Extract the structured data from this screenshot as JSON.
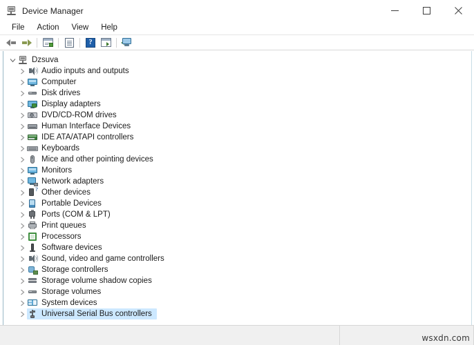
{
  "window": {
    "title": "Device Manager",
    "title_icon": "device-manager-icon",
    "controls": {
      "minimize": "minimize-icon",
      "maximize": "maximize-icon",
      "close": "close-icon"
    }
  },
  "menubar": {
    "items": [
      {
        "label": "File"
      },
      {
        "label": "Action"
      },
      {
        "label": "View"
      },
      {
        "label": "Help"
      }
    ]
  },
  "toolbar": {
    "buttons": [
      {
        "name": "back-arrow-icon",
        "tip": "Back"
      },
      {
        "name": "forward-arrow-icon",
        "tip": "Forward"
      },
      {
        "name": "properties-icon",
        "tip": "Properties"
      },
      {
        "name": "update-driver-icon",
        "tip": "Update driver"
      },
      {
        "name": "help-icon",
        "tip": "Help",
        "glyph": "?"
      },
      {
        "name": "scan-hardware-icon",
        "tip": "Scan for hardware changes"
      },
      {
        "name": "show-devices-icon",
        "tip": "Show devices"
      }
    ]
  },
  "tree": {
    "root": {
      "label": "Dzsuva",
      "icon": "computer-root-icon",
      "expanded": true
    },
    "items": [
      {
        "label": "Audio inputs and outputs",
        "icon": "speaker-icon"
      },
      {
        "label": "Computer",
        "icon": "monitor-icon"
      },
      {
        "label": "Disk drives",
        "icon": "disk-drive-icon"
      },
      {
        "label": "Display adapters",
        "icon": "display-adapter-icon"
      },
      {
        "label": "DVD/CD-ROM drives",
        "icon": "dvd-drive-icon"
      },
      {
        "label": "Human Interface Devices",
        "icon": "hid-icon"
      },
      {
        "label": "IDE ATA/ATAPI controllers",
        "icon": "ide-controller-icon"
      },
      {
        "label": "Keyboards",
        "icon": "keyboard-icon"
      },
      {
        "label": "Mice and other pointing devices",
        "icon": "mouse-icon"
      },
      {
        "label": "Monitors",
        "icon": "monitor-icon"
      },
      {
        "label": "Network adapters",
        "icon": "network-adapter-icon"
      },
      {
        "label": "Other devices",
        "icon": "unknown-device-icon"
      },
      {
        "label": "Portable Devices",
        "icon": "portable-device-icon"
      },
      {
        "label": "Ports (COM & LPT)",
        "icon": "port-plug-icon"
      },
      {
        "label": "Print queues",
        "icon": "printer-icon"
      },
      {
        "label": "Processors",
        "icon": "processor-icon"
      },
      {
        "label": "Software devices",
        "icon": "software-device-icon"
      },
      {
        "label": "Sound, video and game controllers",
        "icon": "speaker-icon"
      },
      {
        "label": "Storage controllers",
        "icon": "storage-controller-icon"
      },
      {
        "label": "Storage volume shadow copies",
        "icon": "storage-stack-icon"
      },
      {
        "label": "Storage volumes",
        "icon": "disk-drive-icon"
      },
      {
        "label": "System devices",
        "icon": "system-device-icon"
      },
      {
        "label": "Universal Serial Bus controllers",
        "icon": "usb-icon",
        "selected": true
      }
    ]
  },
  "statusbar": {
    "text": "",
    "watermark": "wsxdn.com"
  },
  "colors": {
    "selection": "#cce8ff",
    "titlebar": "#ffffff",
    "statusbar": "#f0f0f0",
    "text": "#1b1b1b",
    "accent_rail": "#9ab8c6"
  }
}
